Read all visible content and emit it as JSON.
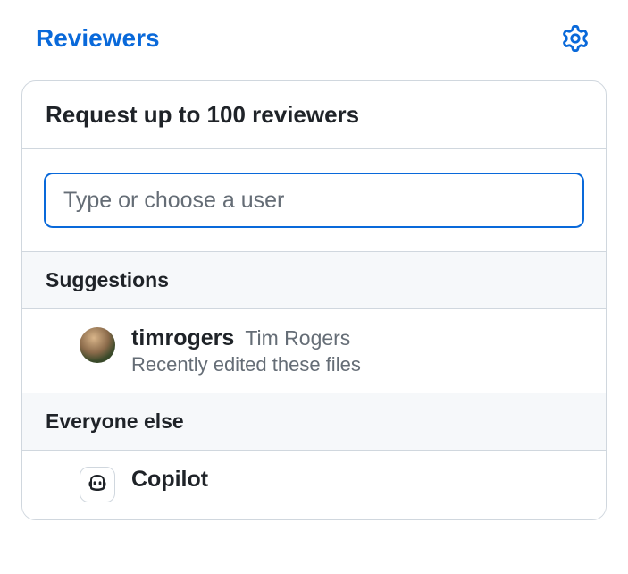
{
  "header": {
    "title": "Reviewers"
  },
  "panel": {
    "title": "Request up to 100 reviewers",
    "search_placeholder": "Type or choose a user",
    "search_value": ""
  },
  "sections": {
    "suggestions": {
      "label": "Suggestions",
      "items": [
        {
          "username": "timrogers",
          "fullname": "Tim Rogers",
          "meta": "Recently edited these files",
          "avatar_kind": "photo"
        }
      ]
    },
    "everyone_else": {
      "label": "Everyone else",
      "items": [
        {
          "username": "Copilot",
          "fullname": "",
          "meta": "",
          "avatar_kind": "copilot"
        }
      ]
    }
  }
}
